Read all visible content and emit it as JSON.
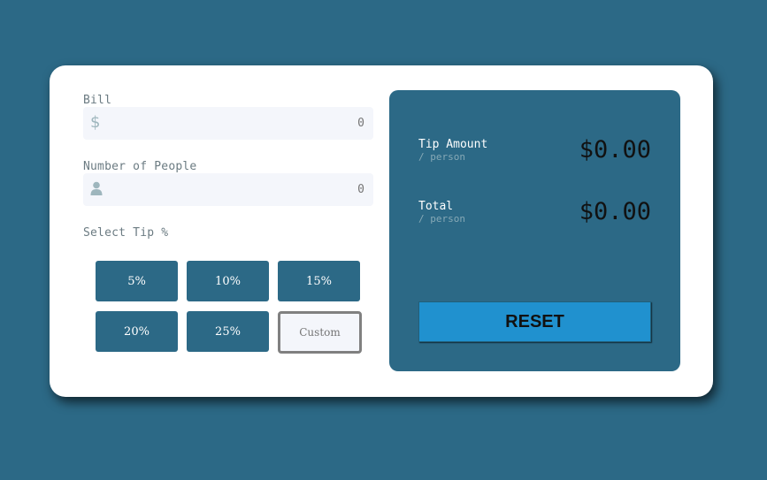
{
  "bill": {
    "label": "Bill",
    "icon": "dollar-icon",
    "value": "",
    "placeholder": "0"
  },
  "people": {
    "label": "Number of People",
    "icon": "person-icon",
    "value": "",
    "placeholder": "0"
  },
  "tip": {
    "label": "Select Tip %",
    "options": [
      "5%",
      "10%",
      "15%",
      "20%",
      "25%"
    ],
    "custom_placeholder": "Custom"
  },
  "results": {
    "tip_amount_label": "Tip Amount",
    "tip_amount_sub": "/ person",
    "tip_amount_value": "$0.00",
    "total_label": "Total",
    "total_sub": "/ person",
    "total_value": "$0.00"
  },
  "reset_label": "RESET",
  "colors": {
    "page_background": "#2c6986",
    "accent_dark": "#2c6986",
    "reset_button": "#2091cf",
    "input_background": "#f4f6fb"
  }
}
